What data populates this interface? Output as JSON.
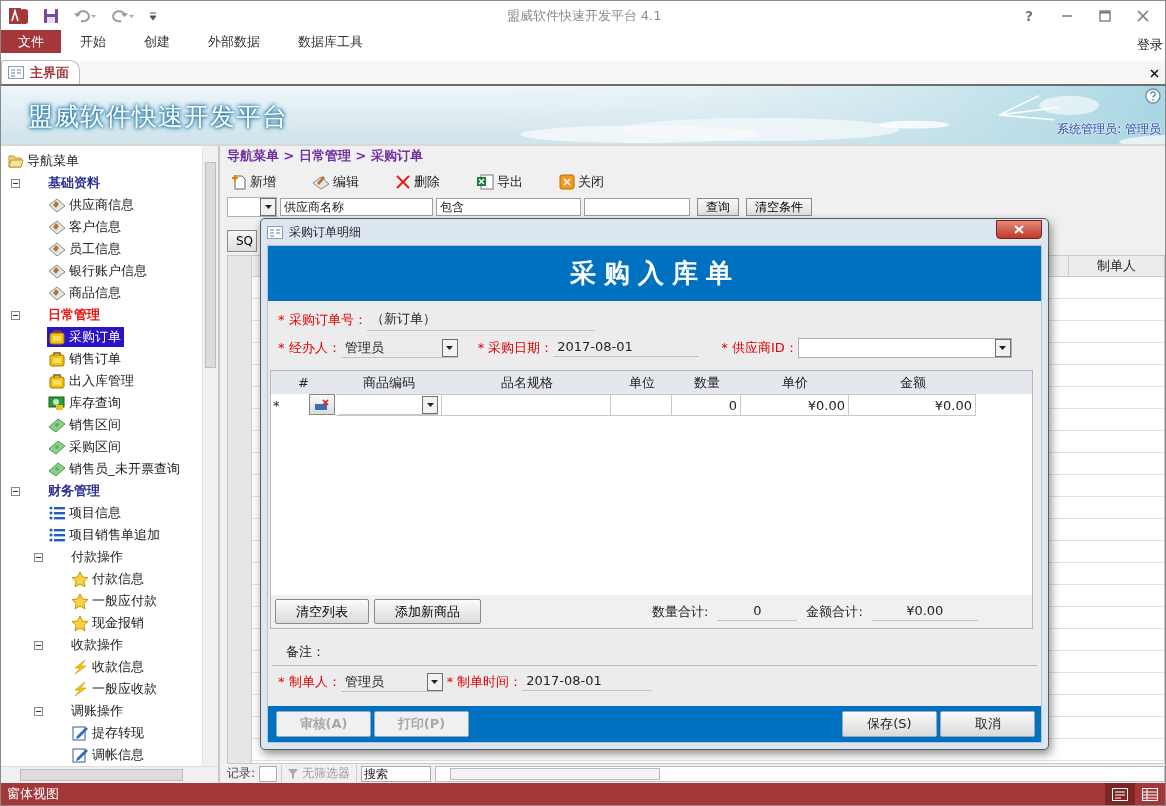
{
  "window": {
    "title": "盟威软件快速开发平台 4.1",
    "help": "?"
  },
  "ribbon": {
    "tabs": [
      {
        "label": "文件",
        "selected": true
      },
      {
        "label": "开始",
        "selected": false
      },
      {
        "label": "创建",
        "selected": false
      },
      {
        "label": "外部数据",
        "selected": false
      },
      {
        "label": "数据库工具",
        "selected": false
      }
    ],
    "login": "登录"
  },
  "documents": {
    "tabs": [
      {
        "label": "主界面",
        "selected": true
      }
    ]
  },
  "banner": {
    "title": "盟威软件快速开发平台",
    "user": "系统管理员: 管理员"
  },
  "nav": {
    "root": "导航菜单",
    "items": [
      {
        "label": "基础资料",
        "kind": "group",
        "active": false,
        "expanded": true,
        "children": [
          {
            "label": "供应商信息",
            "kind": "record",
            "selected": false
          },
          {
            "label": "客户信息",
            "kind": "record",
            "selected": false
          },
          {
            "label": "员工信息",
            "kind": "record",
            "selected": false
          },
          {
            "label": "银行账户信息",
            "kind": "record",
            "selected": false
          },
          {
            "label": "商品信息",
            "kind": "record",
            "selected": false
          }
        ]
      },
      {
        "label": "日常管理",
        "kind": "group",
        "active": true,
        "expanded": true,
        "children": [
          {
            "label": "采购订单",
            "kind": "order",
            "selected": true
          },
          {
            "label": "销售订单",
            "kind": "order",
            "selected": false
          },
          {
            "label": "出入库管理",
            "kind": "order",
            "selected": false
          },
          {
            "label": "库存查询",
            "kind": "stock",
            "selected": false
          },
          {
            "label": "销售区间",
            "kind": "cash",
            "selected": false
          },
          {
            "label": "采购区间",
            "kind": "cash",
            "selected": false
          },
          {
            "label": "销售员_未开票查询",
            "kind": "cash",
            "selected": false
          }
        ]
      },
      {
        "label": "财务管理",
        "kind": "group",
        "active": false,
        "expanded": true,
        "children": [
          {
            "label": "项目信息",
            "kind": "list",
            "selected": false
          },
          {
            "label": "项目销售单追加",
            "kind": "list",
            "selected": false
          },
          {
            "label": "付款操作",
            "kind": "subgroup",
            "active": false,
            "expanded": true,
            "children": [
              {
                "label": "付款信息",
                "kind": "star",
                "selected": false
              },
              {
                "label": "一般应付款",
                "kind": "star",
                "selected": false
              },
              {
                "label": "现金报销",
                "kind": "star",
                "selected": false
              }
            ]
          },
          {
            "label": "收款操作",
            "kind": "subgroup",
            "active": false,
            "expanded": true,
            "children": [
              {
                "label": "收款信息",
                "kind": "bolt",
                "selected": false
              },
              {
                "label": "一般应收款",
                "kind": "bolt",
                "selected": false
              }
            ]
          },
          {
            "label": "调账操作",
            "kind": "subgroup",
            "active": false,
            "expanded": true,
            "children": [
              {
                "label": "提存转现",
                "kind": "note",
                "selected": false
              },
              {
                "label": "调帐信息",
                "kind": "note",
                "selected": false
              }
            ]
          }
        ]
      }
    ]
  },
  "breadcrumb": "导航菜单 > 日常管理 > 采购订单",
  "toolbar": [
    {
      "label": "新增",
      "kind": "new"
    },
    {
      "label": "编辑",
      "kind": "edit"
    },
    {
      "label": "删除",
      "kind": "delete"
    },
    {
      "label": "导出",
      "kind": "export"
    },
    {
      "label": "关闭",
      "kind": "close"
    }
  ],
  "filter": {
    "field": "供应商名称",
    "operator": "包含",
    "query_button": "查询",
    "clear_button": "清空条件",
    "sql_button": "SQ"
  },
  "grid": {
    "columns": [
      "制单人"
    ]
  },
  "record_nav": {
    "label": "记录:",
    "filter": "无筛选器",
    "search": "搜索"
  },
  "dialog": {
    "title": "采购订单明细",
    "heading": "采购入库单",
    "order_no": {
      "label": "* 采购订单号：",
      "value": "（新订单）"
    },
    "handler": {
      "label": "* 经办人：",
      "value": "管理员"
    },
    "date": {
      "label": "* 采购日期：",
      "value": "2017-08-01"
    },
    "supplier": {
      "label": "* 供应商ID："
    },
    "lines": {
      "columns": [
        "#",
        "商品编码",
        "品名规格",
        "单位",
        "数量",
        "单价",
        "金额"
      ],
      "new_row": {
        "marker": "*",
        "quantity": "0",
        "price": "¥0.00",
        "amount": "¥0.00"
      },
      "clear_button": "清空列表",
      "add_button": "添加新商品",
      "qty_total_label": "数量合计:",
      "qty_total": "0",
      "amount_total_label": "金额合计:",
      "amount_total": "¥0.00"
    },
    "remark_label": "备注：",
    "creator": {
      "label": "* 制单人：",
      "value": "管理员"
    },
    "created_at": {
      "label": "* 制单时间：",
      "value": "2017-08-01"
    },
    "left_buttons": [
      {
        "label": "审核(A)",
        "disabled": true
      },
      {
        "label": "打印(P)",
        "disabled": true
      }
    ],
    "right_buttons": [
      {
        "label": "保存(S)",
        "disabled": false
      },
      {
        "label": "取消",
        "disabled": false
      }
    ]
  },
  "status_bar": {
    "text": "窗体视图",
    "views": [
      {
        "kind": "form",
        "selected": true
      },
      {
        "kind": "datasheet",
        "selected": false
      }
    ]
  }
}
